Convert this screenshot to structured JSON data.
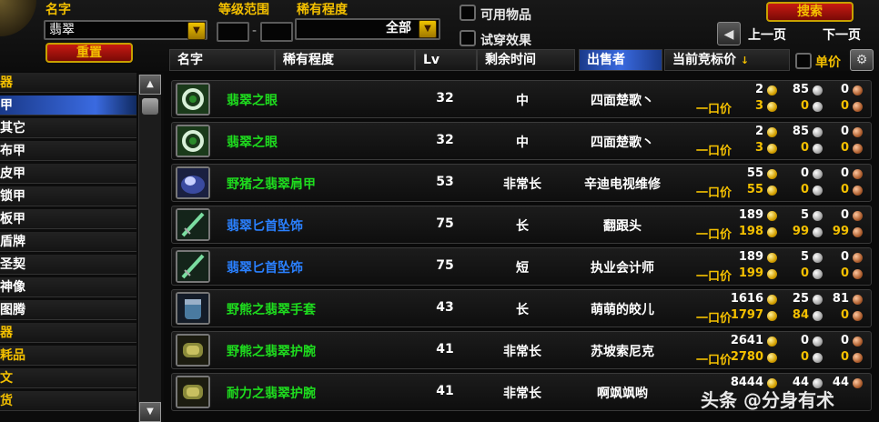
{
  "search": {
    "name_label": "名字",
    "name_value": "翡翠",
    "level_label": "等级范围",
    "rarity_label": "稀有程度",
    "rarity_value": "全部",
    "usable_label": "可用物品",
    "tryon_label": "试穿效果",
    "search_button": "搜索",
    "reset_button": "重置",
    "prev_page": "上一页",
    "next_page": "下一页"
  },
  "categories": [
    {
      "label": "器",
      "color": "gold",
      "selected": false
    },
    {
      "label": "甲",
      "color": "white",
      "selected": true
    },
    {
      "label": "其它",
      "color": "white",
      "selected": false
    },
    {
      "label": "布甲",
      "color": "white",
      "selected": false
    },
    {
      "label": "皮甲",
      "color": "white",
      "selected": false
    },
    {
      "label": "锁甲",
      "color": "white",
      "selected": false
    },
    {
      "label": "板甲",
      "color": "white",
      "selected": false
    },
    {
      "label": "盾牌",
      "color": "white",
      "selected": false
    },
    {
      "label": "圣契",
      "color": "white",
      "selected": false
    },
    {
      "label": "神像",
      "color": "white",
      "selected": false
    },
    {
      "label": "图腾",
      "color": "white",
      "selected": false
    },
    {
      "label": "器",
      "color": "gold",
      "selected": false
    },
    {
      "label": "耗品",
      "color": "gold",
      "selected": false
    },
    {
      "label": "文",
      "color": "gold",
      "selected": false
    },
    {
      "label": "货",
      "color": "gold",
      "selected": false
    }
  ],
  "columns": {
    "name": "名字",
    "rarity": "稀有程度",
    "lv": "Lv",
    "time": "剩余时间",
    "seller": "出售者",
    "bid": "当前竞标价",
    "sort_arrow": "↓",
    "unit_price": "单价"
  },
  "buyout_label": "一口价",
  "rows": [
    {
      "icon": "ring-icon",
      "name": "翡翠之眼",
      "color": "green",
      "lv": "32",
      "time": "中",
      "seller": "四面楚歌丶",
      "bid": [
        "2",
        "85",
        "0"
      ],
      "buyout": [
        "3",
        "0",
        "0"
      ]
    },
    {
      "icon": "ring-icon",
      "name": "翡翠之眼",
      "color": "green",
      "lv": "32",
      "time": "中",
      "seller": "四面楚歌丶",
      "bid": [
        "2",
        "85",
        "0"
      ],
      "buyout": [
        "3",
        "0",
        "0"
      ]
    },
    {
      "icon": "shoulder-icon",
      "name": "野猪之翡翠肩甲",
      "color": "green",
      "lv": "53",
      "time": "非常长",
      "seller": "辛迪电视维修",
      "bid": [
        "55",
        "0",
        "0"
      ],
      "buyout": [
        "55",
        "0",
        "0"
      ]
    },
    {
      "icon": "dagger-icon",
      "name": "翡翠匕首坠饰",
      "color": "blue",
      "lv": "75",
      "time": "长",
      "seller": "翻跟头",
      "bid": [
        "189",
        "5",
        "0"
      ],
      "buyout": [
        "198",
        "99",
        "99"
      ]
    },
    {
      "icon": "dagger-icon",
      "name": "翡翠匕首坠饰",
      "color": "blue",
      "lv": "75",
      "time": "短",
      "seller": "执业会计师",
      "bid": [
        "189",
        "5",
        "0"
      ],
      "buyout": [
        "199",
        "0",
        "0"
      ]
    },
    {
      "icon": "gauntlet-icon",
      "name": "野熊之翡翠手套",
      "color": "green",
      "lv": "43",
      "time": "长",
      "seller": "萌萌的皎儿",
      "bid": [
        "1616",
        "25",
        "81"
      ],
      "buyout": [
        "1797",
        "84",
        "0"
      ]
    },
    {
      "icon": "bracer-icon",
      "name": "野熊之翡翠护腕",
      "color": "green",
      "lv": "41",
      "time": "非常长",
      "seller": "苏坡索尼克",
      "bid": [
        "2641",
        "0",
        "0"
      ],
      "buyout": [
        "2780",
        "0",
        "0"
      ]
    },
    {
      "icon": "bracer-icon",
      "name": "耐力之翡翠护腕",
      "color": "green",
      "lv": "41",
      "time": "非常长",
      "seller": "啊飒飒哟",
      "bid": [
        "8444",
        "44",
        "44"
      ],
      "buyout": [
        "",
        "",
        ""
      ]
    }
  ],
  "watermark": "头条 @分身有术"
}
